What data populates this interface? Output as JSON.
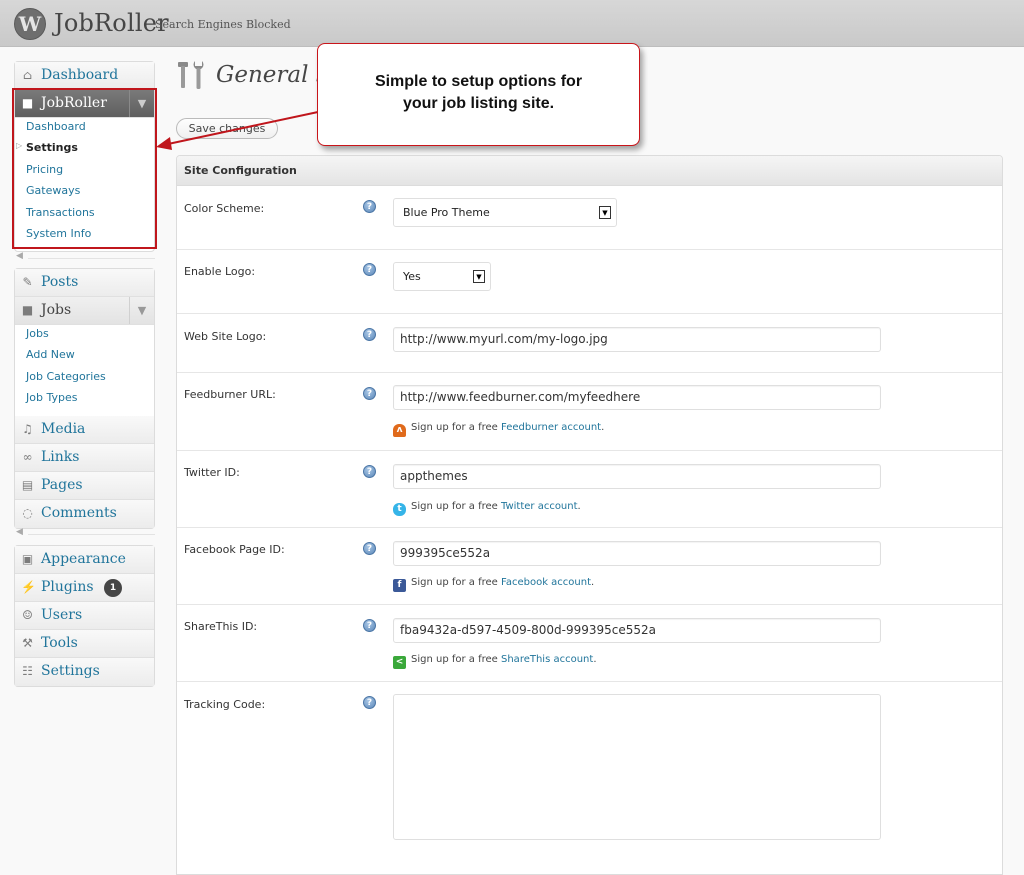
{
  "header": {
    "logo_letter": "W",
    "site_title": "JobRoller",
    "site_note": "Search Engines Blocked"
  },
  "sidebar": {
    "dashboard": "Dashboard",
    "jobroller": {
      "label": "JobRoller",
      "items": [
        "Dashboard",
        "Settings",
        "Pricing",
        "Gateways",
        "Transactions",
        "System Info"
      ],
      "current": "Settings"
    },
    "posts": "Posts",
    "jobs": {
      "label": "Jobs",
      "items": [
        "Jobs",
        "Add New",
        "Job Categories",
        "Job Types"
      ]
    },
    "media": "Media",
    "links": "Links",
    "pages": "Pages",
    "comments": "Comments",
    "appearance": "Appearance",
    "plugins": "Plugins",
    "plugins_badge": "1",
    "users": "Users",
    "tools": "Tools",
    "settings": "Settings"
  },
  "page": {
    "title": "General Settings",
    "save_label": "Save changes"
  },
  "callout": {
    "line1": "Simple to setup options for",
    "line2": "your job listing site."
  },
  "panel": {
    "heading": "Site Configuration",
    "help_glyph": "?",
    "color_scheme": {
      "label": "Color Scheme:",
      "value": "Blue Pro Theme"
    },
    "enable_logo": {
      "label": "Enable Logo:",
      "value": "Yes"
    },
    "web_site_logo": {
      "label": "Web Site Logo:",
      "value": "http://www.myurl.com/my-logo.jpg"
    },
    "feedburner": {
      "label": "Feedburner URL:",
      "value": "http://www.feedburner.com/myfeedhere",
      "signup_prefix": "Sign up for a free",
      "signup_link": "Feedburner account",
      "signup_suffix": "."
    },
    "twitter": {
      "label": "Twitter ID:",
      "value": "appthemes",
      "signup_prefix": "Sign up for a free",
      "signup_link": "Twitter account",
      "signup_suffix": "."
    },
    "facebook": {
      "label": "Facebook Page ID:",
      "value": "999395ce552a",
      "signup_prefix": "Sign up for a free",
      "signup_link": "Facebook account",
      "signup_suffix": "."
    },
    "sharethis": {
      "label": "ShareThis ID:",
      "value": "fba9432a-d597-4509-800d-999395ce552a",
      "signup_prefix": "Sign up for a free",
      "signup_link": "ShareThis account",
      "signup_suffix": "."
    },
    "tracking": {
      "label": "Tracking Code:",
      "value": ""
    }
  },
  "colors": {
    "link": "#21759b",
    "highlight_red": "#c0161c",
    "header_bg": "#cfcfcf"
  }
}
